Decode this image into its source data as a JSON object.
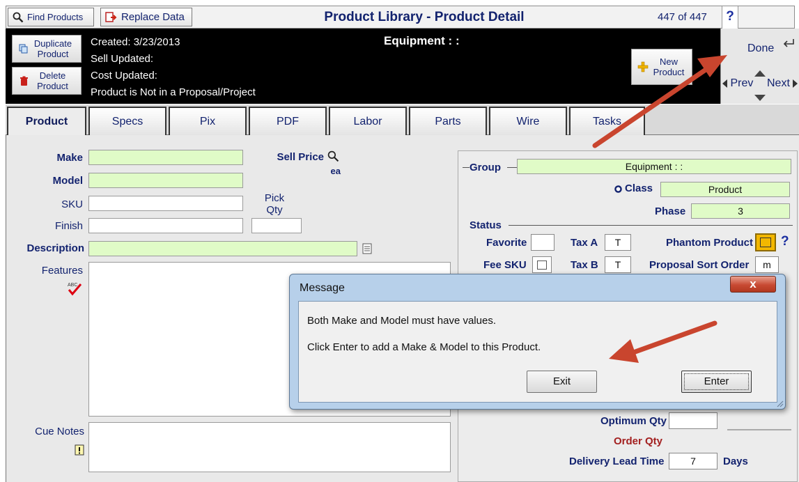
{
  "toolbar": {
    "find_products": "Find Products",
    "replace_data": "Replace Data",
    "title": "Product Library - Product Detail",
    "record_count": "447 of 447",
    "help": "?"
  },
  "info": {
    "duplicate_product": "Duplicate Product",
    "delete_product": "Delete Product",
    "created": "Created: 3/23/2013",
    "sell_updated": "Sell Updated:",
    "cost_updated": "Cost Updated:",
    "proposal_status": "Product is Not in a Proposal/Project",
    "equipment_heading": "Equipment : :",
    "new_product": "New Product"
  },
  "nav": {
    "done": "Done",
    "prev": "Prev",
    "next": "Next"
  },
  "tabs": [
    "Product",
    "Specs",
    "Pix",
    "PDF",
    "Labor",
    "Parts",
    "Wire",
    "Tasks"
  ],
  "form": {
    "make_label": "Make",
    "model_label": "Model",
    "sku_label": "SKU",
    "finish_label": "Finish",
    "description_label": "Description",
    "features_label": "Features",
    "cue_notes_label": "Cue Notes",
    "sell_price_label": "Sell Price",
    "sell_price_unit": "ea",
    "pick_qty_label": "Pick Qty"
  },
  "right": {
    "group_label": "Group",
    "group_value": "Equipment :  :",
    "class_label": "Class",
    "class_value": "Product",
    "phase_label": "Phase",
    "phase_value": "3",
    "status_label": "Status",
    "favorite_label": "Favorite",
    "tax_a_label": "Tax A",
    "tax_a_value": "T",
    "phantom_label": "Phantom Product",
    "fee_sku_label": "Fee SKU",
    "tax_b_label": "Tax B",
    "tax_b_value": "T",
    "sort_order_label": "Proposal Sort Order",
    "sort_order_value": "m",
    "optimum_qty_label": "Optimum Qty",
    "order_qty_label": "Order Qty",
    "lead_time_label": "Delivery Lead Time",
    "lead_time_value": "7",
    "lead_time_unit": "Days",
    "help": "?"
  },
  "dialog": {
    "title": "Message",
    "close": "x",
    "message1": "Both Make and Model must have values.",
    "message2": "Click Enter to add a Make & Model to this Product.",
    "exit": "Exit",
    "enter": "Enter"
  },
  "colors": {
    "required_field": "#e0fbc7",
    "arrow": "#c9452e",
    "title_text": "#12226e"
  }
}
